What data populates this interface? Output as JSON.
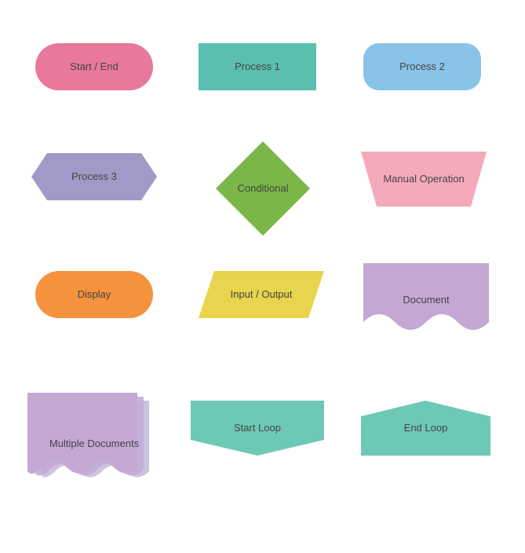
{
  "shapes": {
    "start_end": {
      "label": "Start / End"
    },
    "process1": {
      "label": "Process 1"
    },
    "process2": {
      "label": "Process 2"
    },
    "process3": {
      "label": "Process 3"
    },
    "conditional": {
      "label": "Conditional"
    },
    "manual_operation": {
      "label": "Manual Operation"
    },
    "display": {
      "label": "Display"
    },
    "input_output": {
      "label": "Input / Output"
    },
    "document": {
      "label": "Document"
    },
    "multiple_documents": {
      "label": "Multiple Documents"
    },
    "start_loop": {
      "label": "Start Loop"
    },
    "end_loop": {
      "label": "End Loop"
    }
  },
  "colors": {
    "pink": "#e8799a",
    "teal": "#5bbfb0",
    "blue": "#89c4e8",
    "purple_light": "#a09ac8",
    "green": "#7ab648",
    "pink_light": "#f5aabb",
    "orange": "#f5923e",
    "yellow": "#e8d44d",
    "purple_doc": "#c4a8d4",
    "teal_loop": "#6ec8b8"
  }
}
